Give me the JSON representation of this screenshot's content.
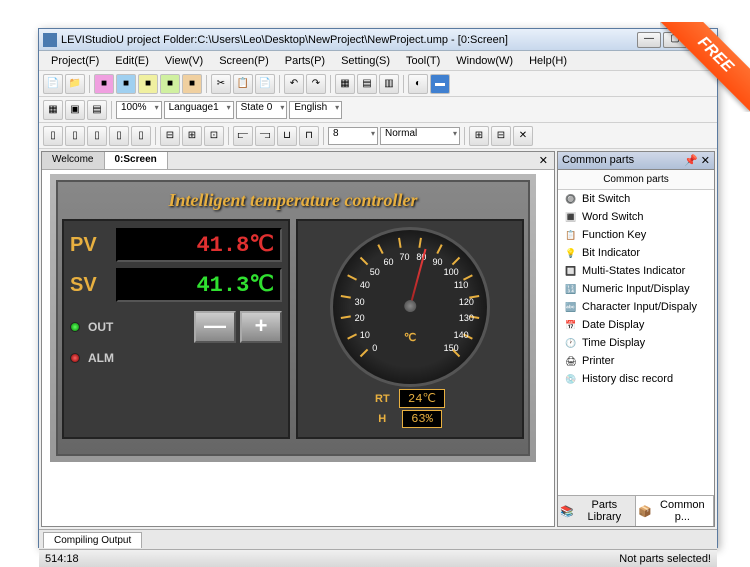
{
  "window": {
    "title": "LEVIStudioU   project Folder:C:\\Users\\Leo\\Desktop\\NewProject\\NewProject.ump   - [0:Screen]"
  },
  "menu": [
    "Project(F)",
    "Edit(E)",
    "View(V)",
    "Screen(P)",
    "Parts(P)",
    "Setting(S)",
    "Tool(T)",
    "Window(W)",
    "Help(H)"
  ],
  "toolbar2": {
    "zoom": "100%",
    "lang": "Language1",
    "state": "State 0",
    "locale": "English"
  },
  "toolbar3": {
    "size": "8",
    "style": "Normal"
  },
  "tabs": {
    "welcome": "Welcome",
    "screen": "0:Screen"
  },
  "hmi": {
    "title": "Intelligent temperature controller",
    "pv_label": "PV",
    "pv_value": "41.8℃",
    "sv_label": "SV",
    "sv_value": "41.3℃",
    "out_label": "OUT",
    "alm_label": "ALM",
    "minus": "—",
    "plus": "+",
    "gauge_unit": "℃",
    "gauge_ticks": [
      "0",
      "10",
      "20",
      "30",
      "40",
      "50",
      "60",
      "70",
      "80",
      "90",
      "100",
      "110",
      "120",
      "130",
      "140",
      "150"
    ],
    "rt_label": "RT",
    "rt_value": "24℃",
    "h_label": "H",
    "h_value": "63%"
  },
  "sidepanel": {
    "title": "Common parts",
    "header": "Common parts",
    "items": [
      {
        "icon": "🔘",
        "label": "Bit Switch"
      },
      {
        "icon": "🔳",
        "label": "Word Switch"
      },
      {
        "icon": "📋",
        "label": "Function Key"
      },
      {
        "icon": "💡",
        "label": "Bit Indicator"
      },
      {
        "icon": "🔲",
        "label": "Multi-States Indicator"
      },
      {
        "icon": "🔢",
        "label": "Numeric Input/Display"
      },
      {
        "icon": "🔤",
        "label": "Character Input/Dispaly"
      },
      {
        "icon": "📅",
        "label": "Date Display"
      },
      {
        "icon": "🕐",
        "label": "Time Display"
      },
      {
        "icon": "🖨",
        "label": "Printer"
      },
      {
        "icon": "💿",
        "label": "History disc record"
      }
    ],
    "tab1": "Parts Library",
    "tab2": "Common p..."
  },
  "bottom": {
    "tab": "Compiling Output"
  },
  "status": {
    "left": "514:18",
    "right": "Not parts selected!"
  },
  "ribbon": "FREE"
}
